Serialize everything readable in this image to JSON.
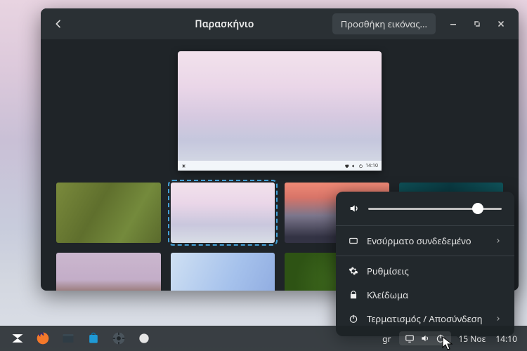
{
  "window": {
    "title": "Παρασκήνιο",
    "add_button": "Προσθήκη εικόνας..."
  },
  "preview_panel": {
    "time": "14:10"
  },
  "slider": {
    "position_pct": 82
  },
  "popup": {
    "wired": "Ενσύρματο συνδεδεμένο",
    "settings": "Ρυθμίσεις",
    "lock": "Κλείδωμα",
    "power": "Τερματισμός / Αποσύνδεση"
  },
  "panel": {
    "keyboard": "gr",
    "date": "15 Νοε",
    "time": "14:10"
  }
}
